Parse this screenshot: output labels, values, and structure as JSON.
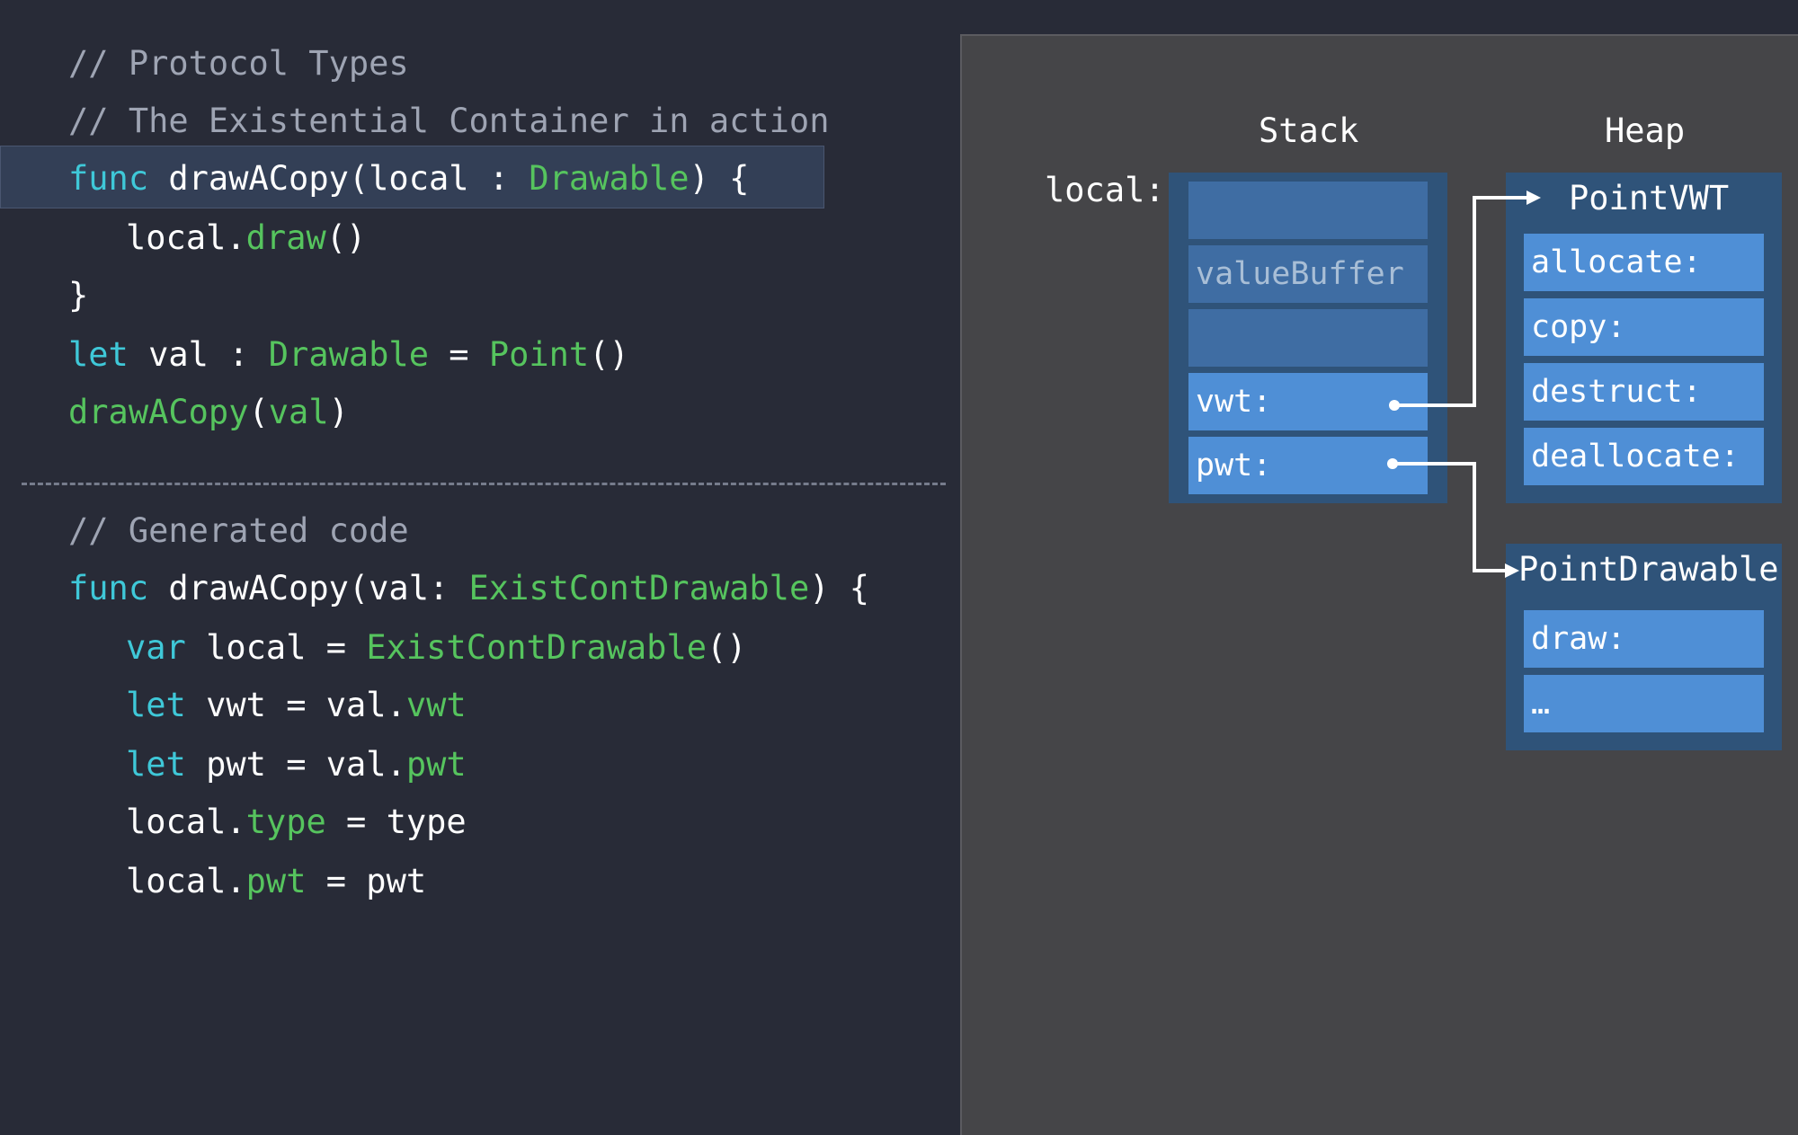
{
  "code": {
    "protocol_section": [
      [
        {
          "t": "// Protocol Types",
          "c": "cm"
        }
      ],
      [
        {
          "t": "// The Existential Container in action",
          "c": "cm"
        }
      ],
      [
        {
          "t": "func",
          "c": "kw"
        },
        {
          "t": " drawACopy(local : ",
          "c": "tx"
        },
        {
          "t": "Drawable",
          "c": "ty"
        },
        {
          "t": ") {",
          "c": "tx"
        }
      ],
      [
        {
          "t": "local.",
          "c": "tx"
        },
        {
          "t": "draw",
          "c": "ty"
        },
        {
          "t": "()",
          "c": "tx"
        }
      ],
      [
        {
          "t": "}",
          "c": "tx"
        }
      ],
      [
        {
          "t": "let",
          "c": "kw"
        },
        {
          "t": " val : ",
          "c": "tx"
        },
        {
          "t": "Drawable",
          "c": "ty"
        },
        {
          "t": " = ",
          "c": "tx"
        },
        {
          "t": "Point",
          "c": "ty"
        },
        {
          "t": "()",
          "c": "tx"
        }
      ],
      [
        {
          "t": "drawACopy",
          "c": "ty"
        },
        {
          "t": "(",
          "c": "tx"
        },
        {
          "t": "val",
          "c": "ty"
        },
        {
          "t": ")",
          "c": "tx"
        }
      ]
    ],
    "generated_section": [
      [
        {
          "t": "// Generated code",
          "c": "cm"
        }
      ],
      [
        {
          "t": "func",
          "c": "kw"
        },
        {
          "t": " drawACopy(val: ",
          "c": "tx"
        },
        {
          "t": "ExistContDrawable",
          "c": "ty"
        },
        {
          "t": ") {",
          "c": "tx"
        }
      ],
      [
        {
          "t": "var",
          "c": "kw"
        },
        {
          "t": " local = ",
          "c": "tx"
        },
        {
          "t": "ExistContDrawable",
          "c": "ty"
        },
        {
          "t": "()",
          "c": "tx"
        }
      ],
      [
        {
          "t": "let",
          "c": "kw"
        },
        {
          "t": " vwt = val.",
          "c": "tx"
        },
        {
          "t": "vwt",
          "c": "ty"
        }
      ],
      [
        {
          "t": "let",
          "c": "kw"
        },
        {
          "t": " pwt = val.",
          "c": "tx"
        },
        {
          "t": "pwt",
          "c": "ty"
        }
      ],
      [
        {
          "t": "local.",
          "c": "tx"
        },
        {
          "t": "type",
          "c": "ty"
        },
        {
          "t": " = type",
          "c": "tx"
        }
      ],
      [
        {
          "t": "local.",
          "c": "tx"
        },
        {
          "t": "pwt",
          "c": "ty"
        },
        {
          "t": " = pwt",
          "c": "tx"
        }
      ]
    ]
  },
  "diagram": {
    "stack_title": "Stack",
    "heap_title": "Heap",
    "local_label": "local:",
    "stack_cells": [
      "",
      "valueBuffer",
      "",
      "vwt:",
      "pwt:"
    ],
    "point_vwt": {
      "title": "PointVWT",
      "entries": [
        "allocate:",
        "copy:",
        "destruct:",
        "deallocate:"
      ]
    },
    "point_drawable": {
      "title": "PointDrawable",
      "entries": [
        "draw:",
        "…"
      ]
    }
  },
  "colors": {
    "background": "#282b37",
    "keyword": "#3fc8d8",
    "type": "#56c45e",
    "comment": "#9ea4b3",
    "panel": "#454548",
    "frame": "#2f5379",
    "cell": "#4f8fd6"
  }
}
